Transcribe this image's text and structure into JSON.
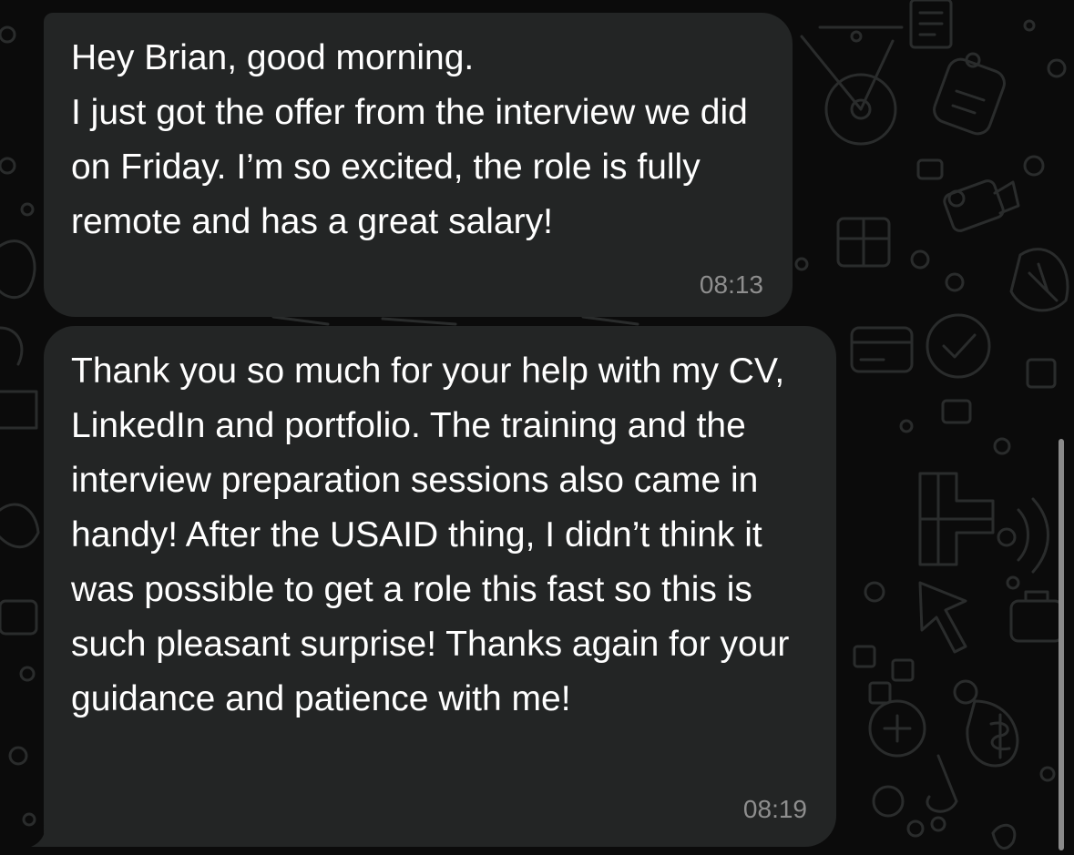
{
  "messages": [
    {
      "text": "Hey Brian, good morning.\nI just got the offer from the interview we did on Friday. I’m so excited, the role is fully remote and has a great salary!",
      "time": "08:13"
    },
    {
      "text": "Thank you so much for your help with my CV, LinkedIn and portfolio. The training and the interview preparation sessions also came in handy!  After the USAID thing, I didn’t think it was possible to get a role this fast so this is such pleasant surprise! Thanks again for your guidance and patience with me!",
      "time": "08:19"
    }
  ],
  "colors": {
    "background": "#0b0b0b",
    "bubble": "#232525",
    "message_text": "#ffffff",
    "timestamp": "#8e8e8e",
    "doodle": "#2a2c2c"
  },
  "background_pattern": "chat-doodle-wallpaper"
}
